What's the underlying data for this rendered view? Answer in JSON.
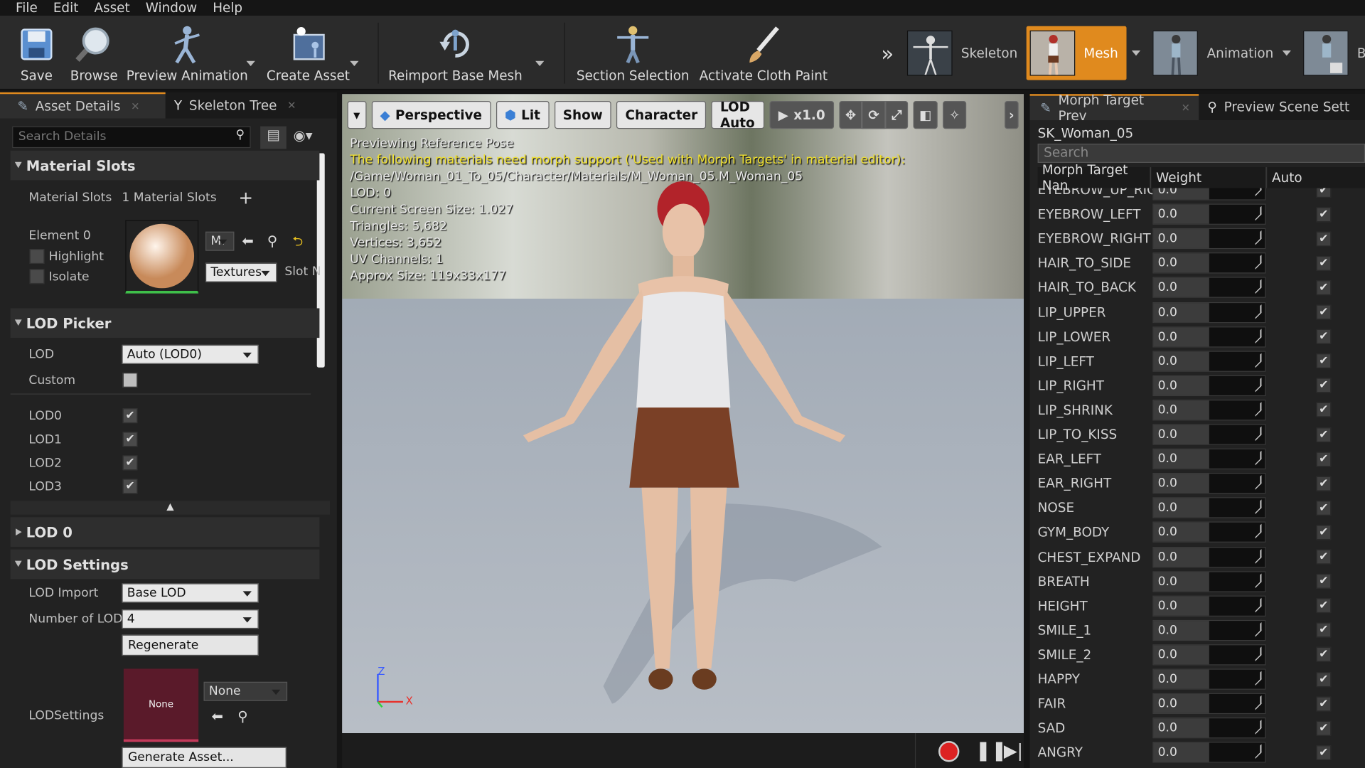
{
  "menu": [
    "File",
    "Edit",
    "Asset",
    "Window",
    "Help"
  ],
  "toolbar": {
    "save": "Save",
    "browse": "Browse",
    "preview_animation": "Preview Animation",
    "create_asset": "Create Asset",
    "reimport": "Reimport Base Mesh",
    "section_selection": "Section Selection",
    "cloth_paint": "Activate Cloth Paint"
  },
  "modes": {
    "skeleton": "Skeleton",
    "mesh": "Mesh",
    "animation": "Animation",
    "blueprint": "Blu"
  },
  "left_panel": {
    "tab_details": "Asset Details",
    "tab_skeleton": "Skeleton Tree",
    "search_placeholder": "Search Details",
    "material_slots_section": "Material Slots",
    "material_slots_label": "Material Slots",
    "material_slots_value": "1 Material Slots",
    "element_label": "Element 0",
    "highlight": "Highlight",
    "isolate": "Isolate",
    "material_short": "M.",
    "textures": "Textures",
    "slot_name": "Slot N",
    "lod_picker_section": "LOD Picker",
    "lod_label": "LOD",
    "lod_value": "Auto (LOD0)",
    "custom_label": "Custom",
    "lods": [
      "LOD0",
      "LOD1",
      "LOD2",
      "LOD3"
    ],
    "lod0_section": "LOD 0",
    "lod_settings_section": "LOD Settings",
    "lod_import_label": "LOD Import",
    "lod_import_value": "Base LOD",
    "number_of_lod_label": "Number of LOD",
    "number_of_lod_value": "4",
    "regenerate": "Regenerate",
    "lodsettings_label": "LODSettings",
    "lodsettings_thumb": "None",
    "lodsettings_value": "None",
    "generate_asset": "Generate Asset..."
  },
  "viewport": {
    "perspective": "Perspective",
    "lit": "Lit",
    "show": "Show",
    "character": "Character",
    "lod_auto": "LOD Auto",
    "speed": "x1.0",
    "info_lines": [
      "Previewing Reference Pose",
      "The following materials need morph support ('Used with Morph Targets' in material editor):",
      "/Game/Woman_01_To_05/Character/Materials/M_Woman_05.M_Woman_05",
      "LOD: 0",
      "Current Screen Size: 1.027",
      "Triangles: 5,682",
      "Vertices: 3,652",
      "UV Channels: 1",
      "Approx Size: 119x33x177"
    ],
    "axis_z": "Z",
    "axis_x": "X"
  },
  "right_panel": {
    "tab_morph": "Morph Target Prev",
    "tab_scene": "Preview Scene Sett",
    "mesh_name": "SK_Woman_05",
    "search_placeholder": "Search",
    "col_name": "Morph Target Nan",
    "col_weight": "Weight",
    "col_auto": "Auto",
    "morphs": [
      {
        "name": "EYEBROW_UP_RIG",
        "weight": "0.0"
      },
      {
        "name": "EYEBROW_LEFT",
        "weight": "0.0"
      },
      {
        "name": "EYEBROW_RIGHT",
        "weight": "0.0"
      },
      {
        "name": "HAIR_TO_SIDE",
        "weight": "0.0"
      },
      {
        "name": "HAIR_TO_BACK",
        "weight": "0.0"
      },
      {
        "name": "LIP_UPPER",
        "weight": "0.0"
      },
      {
        "name": "LIP_LOWER",
        "weight": "0.0"
      },
      {
        "name": "LIP_LEFT",
        "weight": "0.0"
      },
      {
        "name": "LIP_RIGHT",
        "weight": "0.0"
      },
      {
        "name": "LIP_SHRINK",
        "weight": "0.0"
      },
      {
        "name": "LIP_TO_KISS",
        "weight": "0.0"
      },
      {
        "name": "EAR_LEFT",
        "weight": "0.0"
      },
      {
        "name": "EAR_RIGHT",
        "weight": "0.0"
      },
      {
        "name": "NOSE",
        "weight": "0.0"
      },
      {
        "name": "GYM_BODY",
        "weight": "0.0"
      },
      {
        "name": "CHEST_EXPAND",
        "weight": "0.0"
      },
      {
        "name": "BREATH",
        "weight": "0.0"
      },
      {
        "name": "HEIGHT",
        "weight": "0.0"
      },
      {
        "name": "SMILE_1",
        "weight": "0.0"
      },
      {
        "name": "SMILE_2",
        "weight": "0.0"
      },
      {
        "name": "HAPPY",
        "weight": "0.0"
      },
      {
        "name": "FAIR",
        "weight": "0.0"
      },
      {
        "name": "SAD",
        "weight": "0.0"
      },
      {
        "name": "ANGRY",
        "weight": "0.0"
      }
    ]
  },
  "colors": {
    "accent": "#e08a1e",
    "warning_text": "#f0e030"
  }
}
